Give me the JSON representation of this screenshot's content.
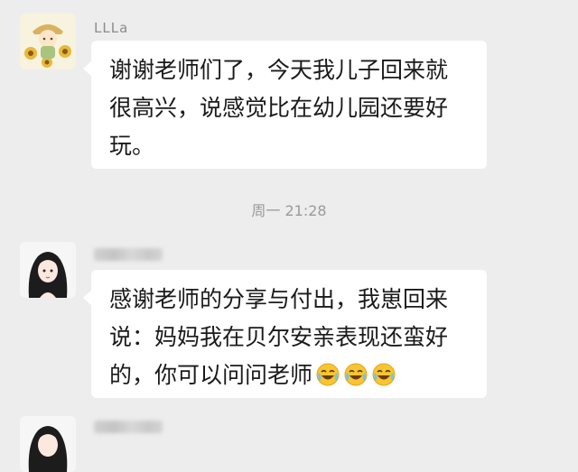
{
  "messages": [
    {
      "sender": "LLLa",
      "avatar": "sunflower-cartoon-avatar",
      "lines": [
        "谢谢老师们了，今天我儿子回来就",
        "很高兴，说感觉比在幼儿园还要好",
        "玩。"
      ]
    },
    {
      "sender_blurred": true,
      "avatar": "anime-girl-avatar",
      "lines": [
        "感谢老师的分享与付出，我崽回来",
        "说：妈妈我在贝尔安亲表现还蛮好",
        "的，你可以问问老师"
      ],
      "emojis": [
        "laughing-crying-emoji",
        "laughing-crying-emoji",
        "laughing-crying-emoji"
      ]
    },
    {
      "sender_blurred": true,
      "avatar": "anime-girl-avatar"
    }
  ],
  "time_divider": "周一 21:28",
  "colors": {
    "background": "#ededed",
    "bubble": "#ffffff",
    "text": "#1a1a1a",
    "meta_text": "#9a9a9a"
  }
}
